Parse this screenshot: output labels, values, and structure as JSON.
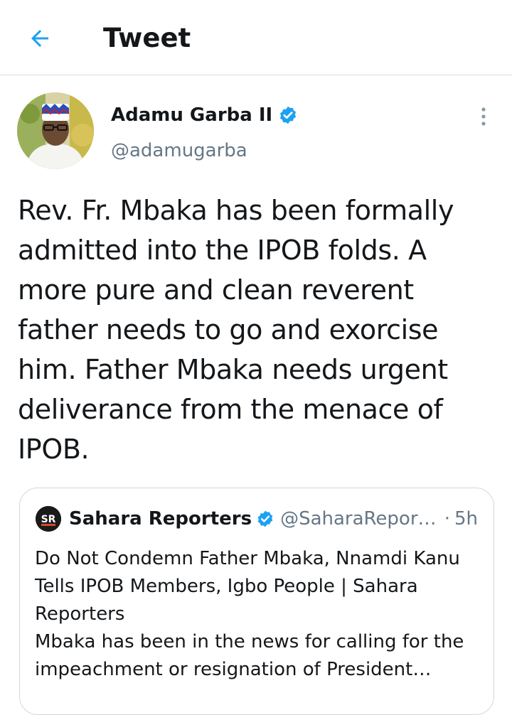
{
  "header": {
    "title": "Tweet",
    "back_icon": "arrow-left-icon",
    "accent_color": "#1da1f2"
  },
  "tweet": {
    "author_name": "Adamu Garba II",
    "author_handle": "@adamugarba",
    "verified": true,
    "text": "Rev. Fr. Mbaka has been formally admitted into the IPOB folds. A more pure and clean reverent father needs to go and exorcise him. Father Mbaka needs urgent deliverance from the menace of IPOB.",
    "more_icon": "more-vertical-icon"
  },
  "quoted": {
    "logo_text": "SR",
    "name": "Sahara Reporters",
    "verified": true,
    "handle": "@SaharaReporters",
    "separator": "·",
    "time": "5h",
    "headline": "Do Not Condemn Father Mbaka, Nnamdi Kanu Tells IPOB Members, Igbo People | Sahara Reporters",
    "description": "Mbaka has been in the news for calling for the impeachment or resignation of President Muhammadu Buhari"
  }
}
